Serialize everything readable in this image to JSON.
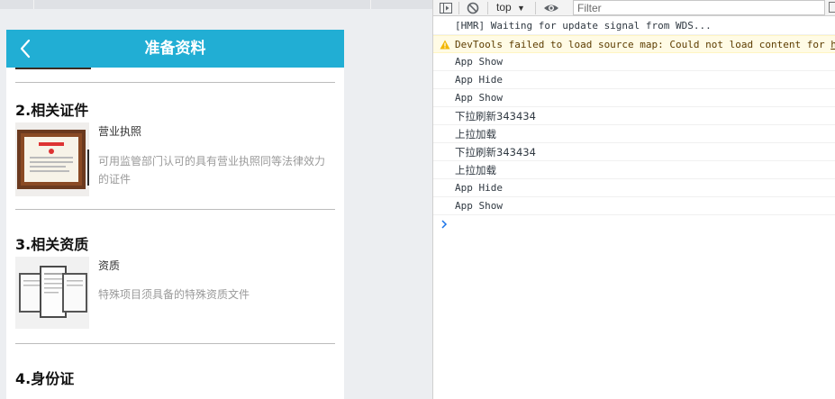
{
  "app": {
    "nav_title": "准备资料"
  },
  "sections": [
    {
      "title": "2.相关证件",
      "item": {
        "name": "营业执照",
        "desc": "可用监管部门认可的具有营业执照同等法律效力的证件",
        "thumb_icon": "business-license-frame-image"
      }
    },
    {
      "title": "3.相关资质",
      "item": {
        "name": "资质",
        "desc": "特殊项目须具备的特殊资质文件",
        "thumb_icon": "qualification-documents-image"
      }
    },
    {
      "title": "4.身份证"
    }
  ],
  "devtools": {
    "context": "top",
    "filter_placeholder": "Filter",
    "toolbar_icons": [
      "sidebar-toggle-icon",
      "clear-console-icon",
      "eye-icon"
    ],
    "logs": [
      {
        "type": "log",
        "text": "[HMR] Waiting for update signal from WDS..."
      },
      {
        "type": "warning",
        "text": "DevTools failed to load source map: Could not load content for ",
        "link": "ht"
      },
      {
        "type": "log",
        "text": "App Show"
      },
      {
        "type": "log",
        "text": "App Hide"
      },
      {
        "type": "log",
        "text": "App Show"
      },
      {
        "type": "log",
        "text": "下拉刷新343434"
      },
      {
        "type": "log",
        "text": "上拉加载"
      },
      {
        "type": "log",
        "text": "下拉刷新343434"
      },
      {
        "type": "log",
        "text": "上拉加载"
      },
      {
        "type": "log",
        "text": "App Hide"
      },
      {
        "type": "log",
        "text": "App Show"
      }
    ]
  },
  "colors": {
    "navbar": "#21aed4",
    "warning_bg": "#fffbe5",
    "prompt": "#1a73e8"
  }
}
